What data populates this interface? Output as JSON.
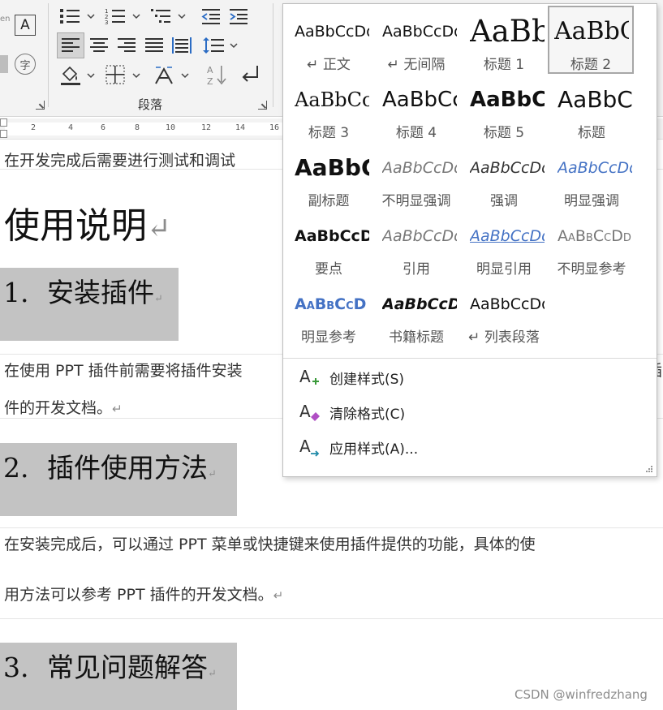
{
  "ribbon": {
    "group_label": "段落",
    "left_partial_letter": "A",
    "left_partial_char": "字",
    "left_partial_text": "en"
  },
  "ruler": {
    "ticks": [
      "2",
      "4",
      "6",
      "8",
      "10",
      "12",
      "14",
      "16"
    ]
  },
  "document": {
    "line_top": "在开发完成后需要进行测试和调试",
    "title": "使用说明",
    "h1_num": "1.",
    "h1_text": "安装插件",
    "para1_line1": "在使用 PPT 插件前需要将插件安装",
    "para1_line1_tail": "插",
    "para1_line2": "件的开发文档。",
    "h2_num": "2.",
    "h2_text": "插件使用方法",
    "para2_line1": "在安装完成后，可以通过 PPT 菜单或快捷键来使用插件提供的功能，具体的使",
    "para2_line2": "用方法可以参考 PPT 插件的开发文档。",
    "h3_num": "3.",
    "h3_text": "常见问题解答",
    "paragraph_mark": "↵"
  },
  "gallery": {
    "styles": [
      {
        "sample": "AaBbCcDd",
        "name": "↵ 正文"
      },
      {
        "sample": "AaBbCcDd",
        "name": "↵ 无间隔"
      },
      {
        "sample": "AaBb",
        "name": "标题 1"
      },
      {
        "sample": "AaBbC",
        "name": "标题 2"
      },
      {
        "sample": "AaBbCc",
        "name": "标题 3"
      },
      {
        "sample": "AaBbCc",
        "name": "标题 4"
      },
      {
        "sample": "AaBbCc",
        "name": "标题 5"
      },
      {
        "sample": "AaBbC",
        "name": "标题"
      },
      {
        "sample": "AaBbC",
        "name": "副标题"
      },
      {
        "sample": "AaBbCcDd",
        "name": "不明显强调"
      },
      {
        "sample": "AaBbCcDd",
        "name": "强调"
      },
      {
        "sample": "AaBbCcDd",
        "name": "明显强调"
      },
      {
        "sample": "AaBbCcDd",
        "name": "要点"
      },
      {
        "sample": "AaBbCcDd",
        "name": "引用"
      },
      {
        "sample": "AaBbCcDd",
        "name": "明显引用"
      },
      {
        "sample": "AaBbCcDd",
        "name": "不明显参考"
      },
      {
        "sample": "AaBbCcD",
        "name": "明显参考"
      },
      {
        "sample": "AaBbCcD",
        "name": "书籍标题"
      },
      {
        "sample": "AaBbCcDd",
        "name": "↵ 列表段落"
      }
    ],
    "selected_index": 3,
    "menu": [
      {
        "label": "创建样式(S)",
        "icon": "create-style-icon"
      },
      {
        "label": "清除格式(C)",
        "icon": "clear-formatting-icon"
      },
      {
        "label": "应用样式(A)...",
        "icon": "apply-styles-icon"
      }
    ],
    "colors": {
      "accent_blue": "#4472c4",
      "plus_green": "#3a9a3a",
      "eraser_purple": "#b04fc4",
      "arrow_teal": "#1f8aa8"
    }
  },
  "watermark": "CSDN @winfredzhang"
}
